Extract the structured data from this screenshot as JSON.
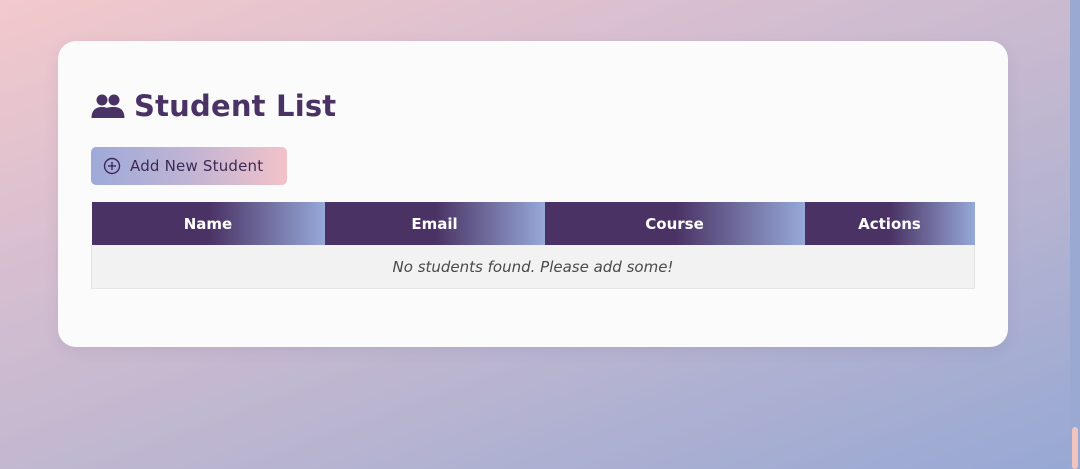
{
  "page": {
    "title": "Student List"
  },
  "toolbar": {
    "add_label": "Add New Student"
  },
  "table": {
    "columns": [
      "Name",
      "Email",
      "Course",
      "Actions"
    ],
    "empty_message": "No students found. Please add some!"
  },
  "icons": {
    "title_icon": "users-icon",
    "add_icon": "plus-circle-icon"
  },
  "colors": {
    "primary": "#4a3264",
    "header_gradient_end": "#96a9d8",
    "button_gradient_start": "#9eaad8",
    "button_gradient_end": "#f2c2c8",
    "card_bg": "#fbfbfc",
    "empty_row_bg": "#f2f2f2"
  }
}
